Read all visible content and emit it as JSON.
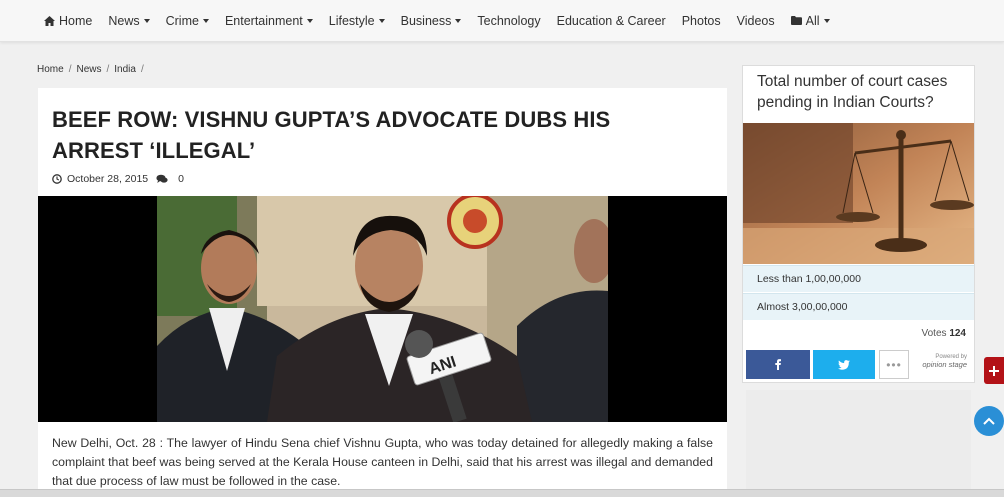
{
  "nav": {
    "home": "Home",
    "news": "News",
    "crime": "Crime",
    "entertainment": "Entertainment",
    "lifestyle": "Lifestyle",
    "business": "Business",
    "technology": "Technology",
    "education": "Education & Career",
    "photos": "Photos",
    "videos": "Videos",
    "all": "All"
  },
  "breadcrumb": [
    "Home",
    "News",
    "India"
  ],
  "article": {
    "headline": "BEEF ROW: VISHNU GUPTA’S ADVOCATE DUBS HIS ARREST ‘ILLEGAL’",
    "date": "October 28, 2015",
    "comments": "0",
    "mic_label": "ANI",
    "body": "New Delhi, Oct. 28 : The lawyer of Hindu Sena chief Vishnu Gupta, who was today detained for allegedly making a false complaint that beef was being served at the Kerala House canteen in Delhi, said that his arrest was illegal and demanded that due process of law must be followed in the case."
  },
  "poll": {
    "question": "Total number of court cases pending in Indian Courts?",
    "options": [
      "Less than 1,00,00,000",
      "Almost 3,00,00,000"
    ],
    "votes_label": "Votes",
    "votes_count": "124",
    "more_label": "•••",
    "powered_by": "Powered by",
    "brand": "opinion stage"
  },
  "colors": {
    "facebook": "#3b5998",
    "twitter": "#1daeed",
    "plus_button": "#b31217",
    "scroll_top": "#2a8fd6",
    "poll_option_bg": "#e8f3f8"
  },
  "icons": {
    "home": "home-icon",
    "folder": "folder-icon",
    "clock": "clock-icon",
    "comments": "comments-icon",
    "facebook": "facebook-icon",
    "twitter": "twitter-icon",
    "plus": "plus-icon",
    "arrow_up": "chevron-up-icon"
  }
}
